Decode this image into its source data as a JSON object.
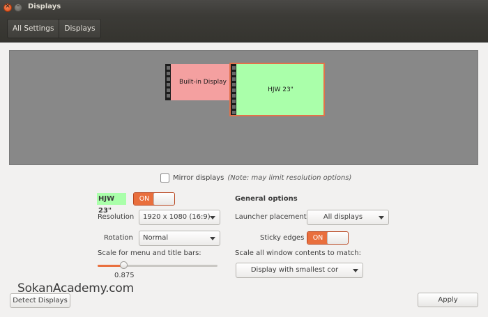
{
  "window": {
    "title": "Displays",
    "close_glyph": "×",
    "min_glyph": "–"
  },
  "toolbar": {
    "crumbs": [
      "All Settings",
      "Displays"
    ]
  },
  "arrangement": {
    "builtin_label": "Built-in Display",
    "hjw_label": "HJW 23\""
  },
  "mirror": {
    "checked": false,
    "label": "Mirror displays",
    "note": "(Note: may limit resolution options)"
  },
  "monitor": {
    "name": "HJW 23\"",
    "power": {
      "state": "ON"
    },
    "resolution_label": "Resolution",
    "resolution_value": "1920 x 1080 (16:9)",
    "rotation_label": "Rotation",
    "rotation_value": "Normal",
    "scale_label": "Scale for menu and title bars:",
    "scale_value": "0.875",
    "scale_fraction": 0.22
  },
  "general": {
    "heading": "General options",
    "launcher_label": "Launcher placement",
    "launcher_value": "All displays",
    "sticky_label": "Sticky edges",
    "sticky_state": "ON",
    "scale_all_label": "Scale all window contents to match:",
    "scale_all_value": "Display with smallest cor"
  },
  "footer": {
    "detect_label": "Detect Displays",
    "apply_label": "Apply"
  },
  "watermark": "SokanAcademy.com",
  "colors": {
    "accent": "#e96f3d",
    "builtin": "#f4a0a0",
    "hjw": "#aaffaa",
    "canvas": "#888888"
  }
}
